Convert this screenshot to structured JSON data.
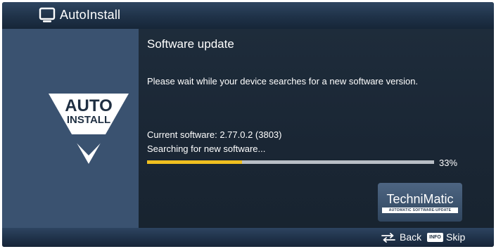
{
  "header": {
    "title": "AutoInstall",
    "icon": "tv-icon"
  },
  "sidebar": {
    "logo_line1": "AUTO",
    "logo_line2": "INSTALL"
  },
  "main": {
    "heading": "Software update",
    "message": "Please wait while your device searches for a new software version.",
    "current_software": "Current software: 2.77.0.2 (3803)",
    "status": "Searching for new software...",
    "progress_percent": 33,
    "progress_label": "33%"
  },
  "brand": {
    "name": "TechniMatic",
    "tagline": "AUTOMATIC SOFTWARE-UPDATE"
  },
  "footer": {
    "back_label": "Back",
    "info_key_label": "INFO",
    "skip_label": "Skip"
  },
  "colors": {
    "progress_fill": "#f0c020",
    "progress_track": "#b8bec5",
    "sidebar_bg": "#3a5270",
    "main_bg": "#1c2936"
  }
}
